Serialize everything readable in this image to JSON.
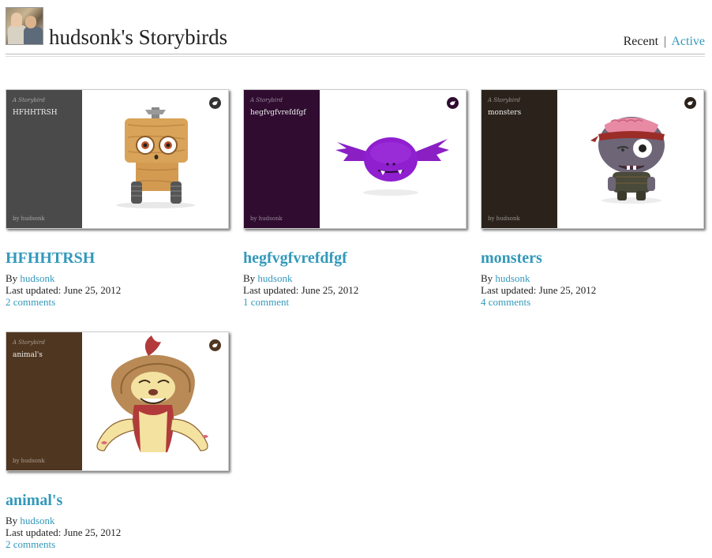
{
  "header": {
    "title": "hudsonk's Storybirds",
    "tab_recent": "Recent",
    "tab_separator": "|",
    "tab_active": "Active"
  },
  "common": {
    "kicker": "A Storybird",
    "by_prefix": "By",
    "updated_prefix": "Last updated:",
    "bird_icon": "storybird-icon"
  },
  "books": [
    {
      "cover_title": "HFHHTRSH",
      "cover_by": "by hudsonk",
      "spine_color": "#4a4a4a",
      "badge_color": "#333333",
      "title": "HFHHTRSH",
      "author": "hudsonk",
      "updated": "June 25, 2012",
      "comments": "2 comments",
      "art": "wooden-robot-character"
    },
    {
      "cover_title": "hegfvgfvrefdfgf",
      "cover_by": "by hudsonk",
      "spine_color": "#2f0c30",
      "badge_color": "#2f0c30",
      "title": "hegfvgfvrefdfgf",
      "author": "hudsonk",
      "updated": "June 25, 2012",
      "comments": "1 comment",
      "art": "purple-bat-monster"
    },
    {
      "cover_title": "monsters",
      "cover_by": "by hudsonk",
      "spine_color": "#2b231b",
      "badge_color": "#2b231b",
      "title": "monsters",
      "author": "hudsonk",
      "updated": "June 25, 2012",
      "comments": "4 comments",
      "art": "zombie-monster"
    },
    {
      "cover_title": "animal's",
      "cover_by": "by hudsonk",
      "spine_color": "#4f3620",
      "badge_color": "#4f3620",
      "title": "animal's",
      "author": "hudsonk",
      "updated": "June 25, 2012",
      "comments": "2 comments",
      "art": "cartoon-lion"
    }
  ]
}
